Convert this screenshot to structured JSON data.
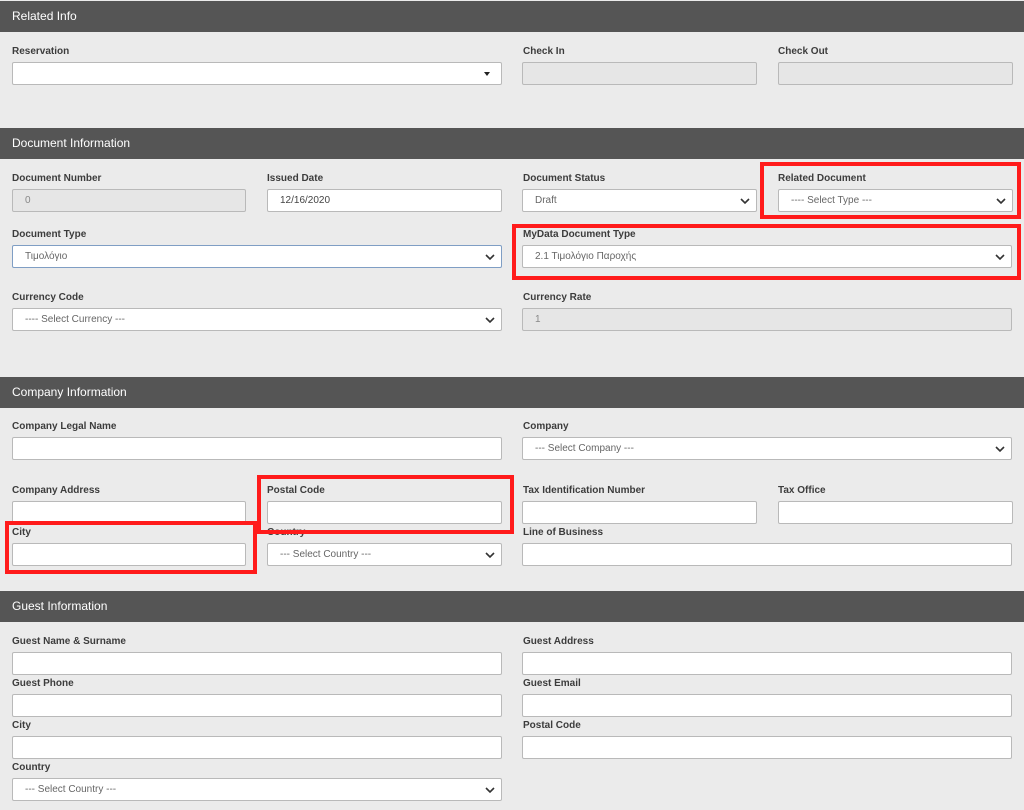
{
  "related_info": {
    "title": "Related Info",
    "reservation_label": "Reservation",
    "reservation_value": "",
    "check_in_label": "Check In",
    "check_in_value": "",
    "check_out_label": "Check Out",
    "check_out_value": ""
  },
  "document_info": {
    "title": "Document Information",
    "document_number_label": "Document Number",
    "document_number_value": "0",
    "issued_date_label": "Issued Date",
    "issued_date_value": "12/16/2020",
    "document_status_label": "Document Status",
    "document_status_value": "Draft",
    "related_document_label": "Related Document",
    "related_document_value": "---- Select Type ---",
    "document_type_label": "Document Type",
    "document_type_value": "Τιμολόγιο",
    "mydata_type_label": "MyData Document Type",
    "mydata_type_value": "2.1 Τιμολόγιο Παροχής",
    "currency_code_label": "Currency Code",
    "currency_code_value": "---- Select Currency ---",
    "currency_rate_label": "Currency Rate",
    "currency_rate_value": "1"
  },
  "company_info": {
    "title": "Company Information",
    "legal_name_label": "Company Legal Name",
    "legal_name_value": "",
    "company_label": "Company",
    "company_value": "--- Select Company ---",
    "address_label": "Company Address",
    "address_value": "",
    "postal_code_label": "Postal Code",
    "postal_code_value": "",
    "tax_id_label": "Tax Identification Number",
    "tax_id_value": "",
    "tax_office_label": "Tax Office",
    "tax_office_value": "",
    "city_label": "City",
    "city_value": "",
    "country_label": "Country",
    "country_value": "--- Select Country ---",
    "line_of_business_label": "Line of Business",
    "line_of_business_value": ""
  },
  "guest_info": {
    "title": "Guest Information",
    "name_label": "Guest Name & Surname",
    "name_value": "",
    "address_label": "Guest Address",
    "address_value": "",
    "phone_label": "Guest Phone",
    "phone_value": "",
    "email_label": "Guest Email",
    "email_value": "",
    "city_label": "City",
    "city_value": "",
    "postal_code_label": "Postal Code",
    "postal_code_value": "",
    "country_label": "Country",
    "country_value": "--- Select Country ---"
  },
  "colors": {
    "section_header_bg": "#555555",
    "highlight": "#ff1b1b",
    "page_bg": "#ebebeb"
  },
  "icons": {
    "select_arrow": "chevron-down-icon",
    "reservation_arrow": "caret-down-icon"
  }
}
